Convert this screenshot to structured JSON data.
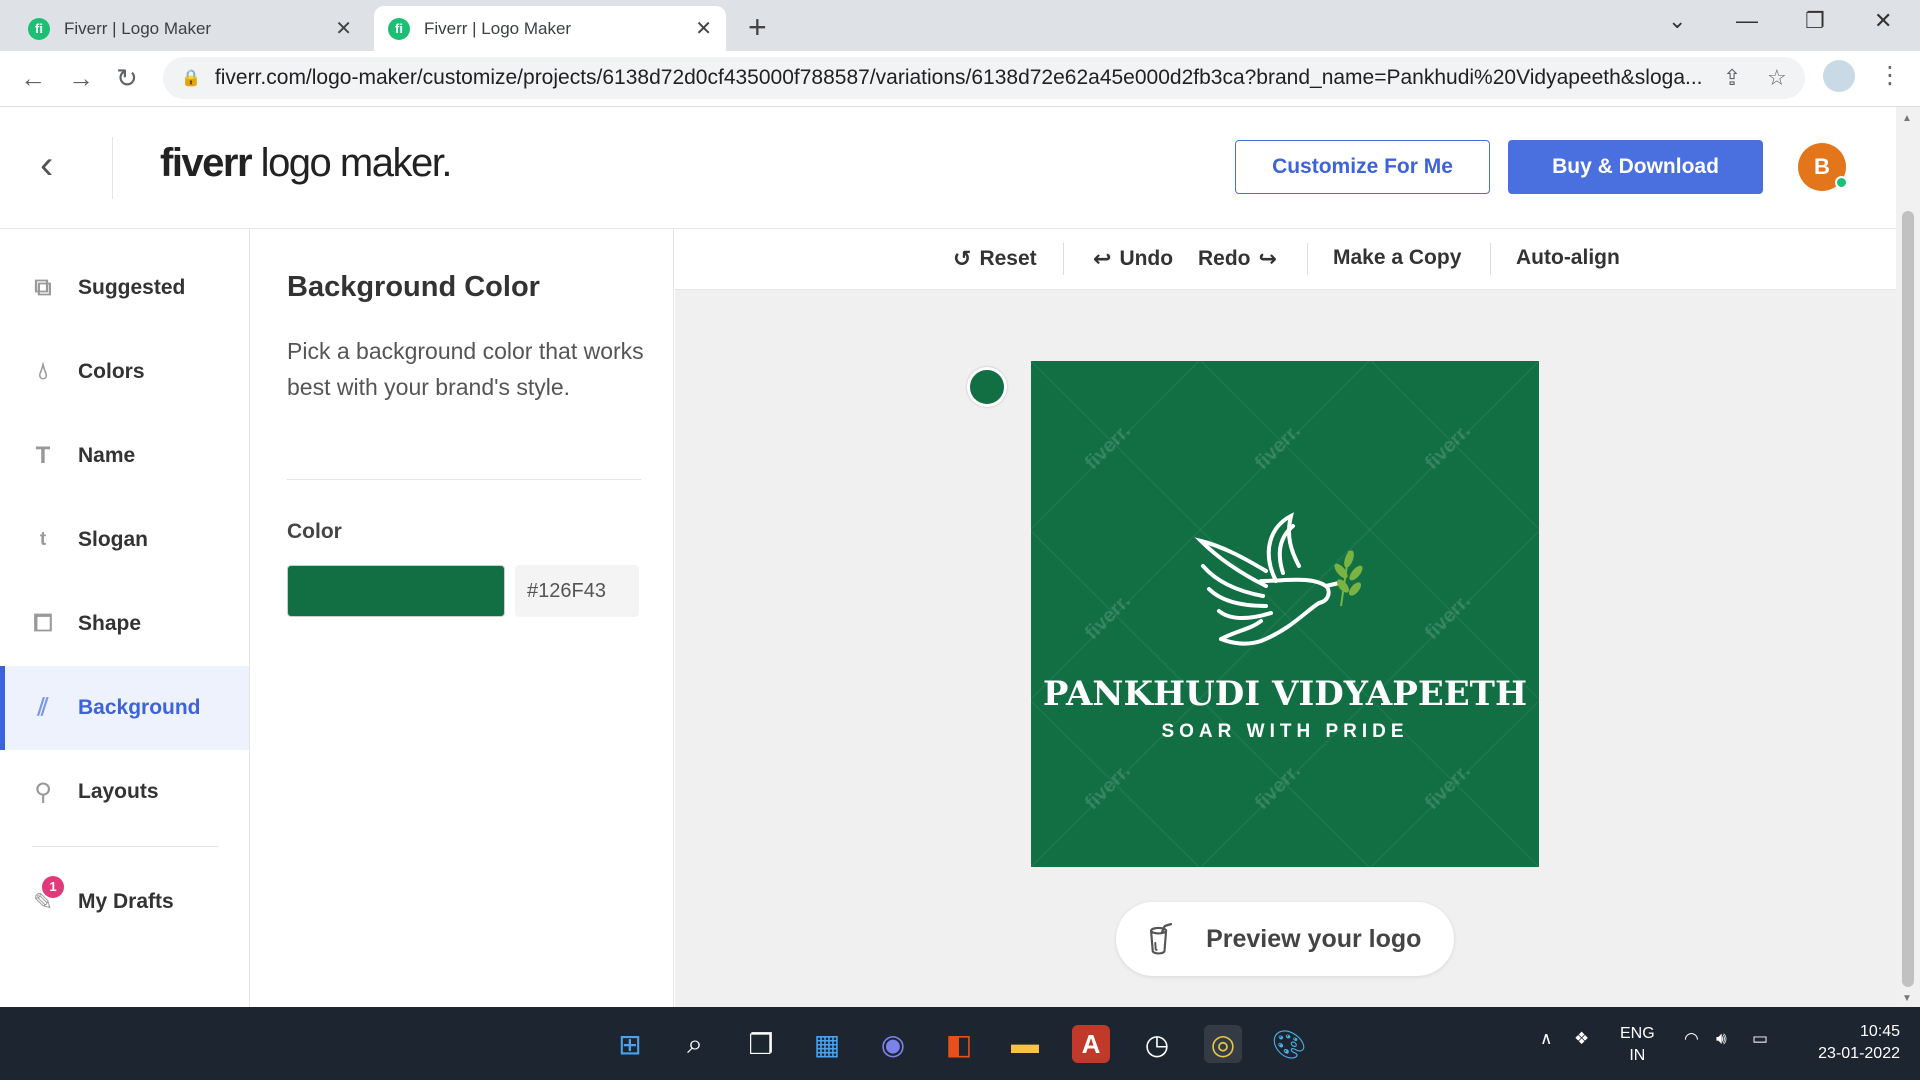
{
  "browser": {
    "tabs": [
      {
        "title": "Fiverr | Logo Maker",
        "favicon": "fi",
        "active": false
      },
      {
        "title": "Fiverr | Logo Maker",
        "favicon": "fi",
        "active": true
      }
    ],
    "url": "fiverr.com/logo-maker/customize/projects/6138d72d0cf435000f788587/variations/6138d72e62a45e000d2fb3ca?brand_name=Pankhudi%20Vidyapeeth&sloga..."
  },
  "header": {
    "logo_bold": "fiverr",
    "logo_rest": " logo maker.",
    "customize_label": "Customize For Me",
    "buy_label": "Buy & Download",
    "avatar_letter": "B"
  },
  "sidebar": {
    "items": [
      {
        "label": "Suggested",
        "icon": "suggested-icon"
      },
      {
        "label": "Colors",
        "icon": "droplet-icon"
      },
      {
        "label": "Name",
        "icon": "text-icon"
      },
      {
        "label": "Slogan",
        "icon": "slogan-icon"
      },
      {
        "label": "Shape",
        "icon": "shape-icon"
      },
      {
        "label": "Background",
        "icon": "background-icon",
        "active": true
      },
      {
        "label": "Layouts",
        "icon": "layouts-icon"
      }
    ],
    "drafts_label": "My Drafts",
    "drafts_badge": "1"
  },
  "panel": {
    "title": "Background Color",
    "description": "Pick a background color that works best with your brand's style.",
    "color_label": "Color",
    "color_hex": "#126F43"
  },
  "toolbar": {
    "reset": "Reset",
    "undo": "Undo",
    "redo": "Redo",
    "copy": "Make a Copy",
    "align": "Auto-align"
  },
  "logo_preview": {
    "brand_name": "PANKHUDI VIDYAPEETH",
    "slogan": "SOAR WITH PRIDE",
    "background": "#126F43",
    "watermark": "fiverr."
  },
  "preview_button": "Preview your logo",
  "taskbar": {
    "lang_top": "ENG",
    "lang_bottom": "IN",
    "time": "10:45",
    "date": "23-01-2022"
  },
  "colors": {
    "accent": "#4A70E0",
    "fiverr_green": "#1DBF73",
    "logo_bg": "#126F43"
  }
}
